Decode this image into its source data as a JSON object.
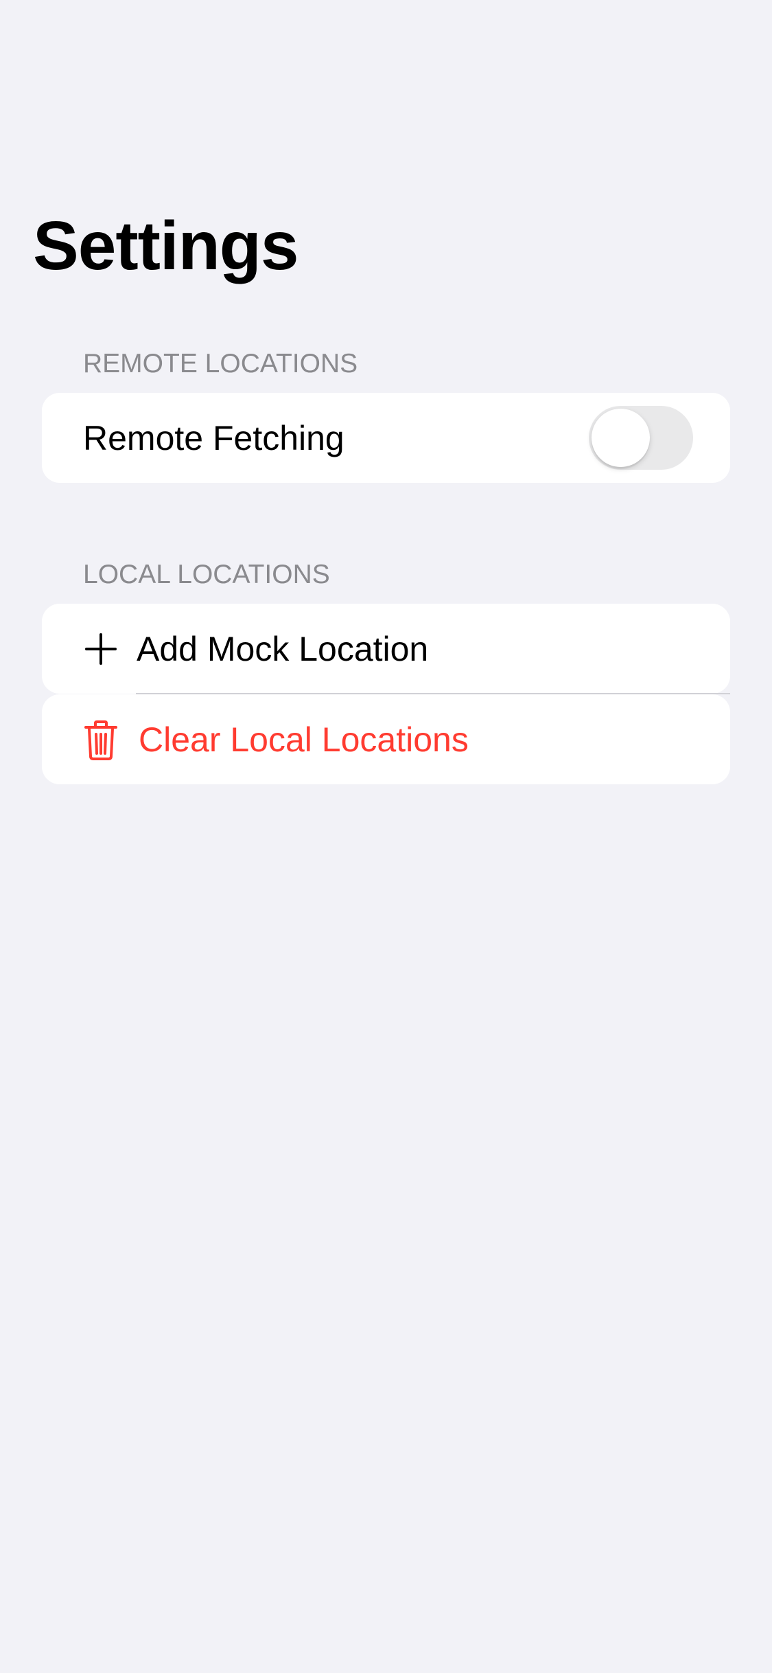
{
  "header": {
    "title": "Settings"
  },
  "sections": {
    "remote": {
      "header": "REMOTE LOCATIONS",
      "remote_fetching": {
        "label": "Remote Fetching",
        "enabled": false
      }
    },
    "local": {
      "header": "LOCAL LOCATIONS",
      "add_mock": {
        "label": "Add Mock Location",
        "icon": "plus-icon"
      },
      "clear_local": {
        "label": "Clear Local Locations",
        "icon": "trash-icon"
      }
    }
  },
  "colors": {
    "background": "#f2f2f7",
    "destructive": "#ff3b30",
    "toggle_off": "#e9e9ea",
    "section_header": "#8a8a8e"
  }
}
